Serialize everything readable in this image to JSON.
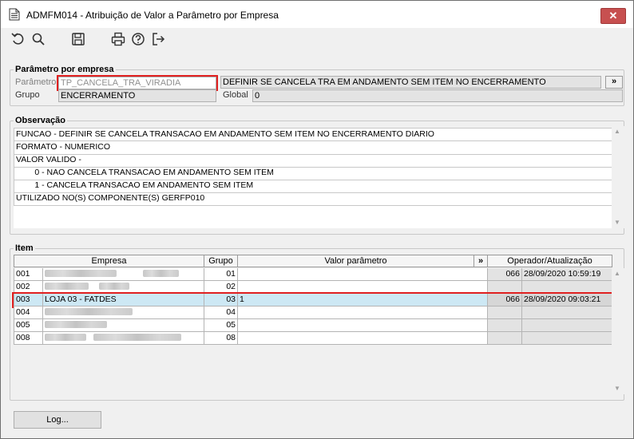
{
  "window": {
    "title": "ADMFM014 - Atribuição de Valor a Parâmetro por Empresa",
    "close_label": "✕"
  },
  "toolbar": {
    "items": [
      {
        "icon": "undo-icon"
      },
      {
        "icon": "search-icon"
      },
      {
        "icon": "save-icon"
      },
      {
        "icon": "print-icon"
      },
      {
        "icon": "help-icon"
      },
      {
        "icon": "exit-icon"
      }
    ]
  },
  "parametro": {
    "group_title": "Parâmetro por empresa",
    "parametro_label": "Parâmetro",
    "parametro_value": "TP_CANCELA_TRA_VIRADIA",
    "descricao_value": "DEFINIR SE CANCELA TRA EM ANDAMENTO SEM ITEM NO ENCERRAMENTO",
    "more_label": "»",
    "grupo_label": "Grupo",
    "grupo_value": "ENCERRAMENTO",
    "global_label": "Global",
    "global_value": "0"
  },
  "observacao": {
    "group_title": "Observação",
    "lines": [
      "FUNCAO - DEFINIR SE CANCELA TRANSACAO EM ANDAMENTO SEM ITEM NO ENCERRAMENTO DIARIO",
      "FORMATO - NUMERICO",
      "VALOR VALIDO -",
      "        0 - NAO CANCELA TRANSACAO EM ANDAMENTO SEM ITEM",
      "        1 - CANCELA TRANSACAO EM ANDAMENTO SEM ITEM",
      "UTILIZADO NO(S) COMPONENTE(S) GERFP010"
    ]
  },
  "item": {
    "group_title": "Item",
    "columns": {
      "empresa": "Empresa",
      "grupo": "Grupo",
      "valor": "Valor parâmetro",
      "more": "»",
      "operador": "Operador/Atualização"
    },
    "rows": [
      {
        "code": "001",
        "empresa": "",
        "grupo": "01",
        "valor": "",
        "operador": "066",
        "atualizacao": "28/09/2020 10:59:19"
      },
      {
        "code": "002",
        "empresa": "",
        "grupo": "02",
        "valor": "",
        "operador": "",
        "atualizacao": ""
      },
      {
        "code": "003",
        "empresa": "LOJA 03 - FATDES",
        "grupo": "03",
        "valor": "1",
        "operador": "066",
        "atualizacao": "28/09/2020 09:03:21"
      },
      {
        "code": "004",
        "empresa": "",
        "grupo": "04",
        "valor": "",
        "operador": "",
        "atualizacao": ""
      },
      {
        "code": "005",
        "empresa": "",
        "grupo": "05",
        "valor": "",
        "operador": "",
        "atualizacao": ""
      },
      {
        "code": "008",
        "empresa": "",
        "grupo": "08",
        "valor": "",
        "operador": "",
        "atualizacao": ""
      }
    ]
  },
  "footer": {
    "log_label": "Log..."
  }
}
